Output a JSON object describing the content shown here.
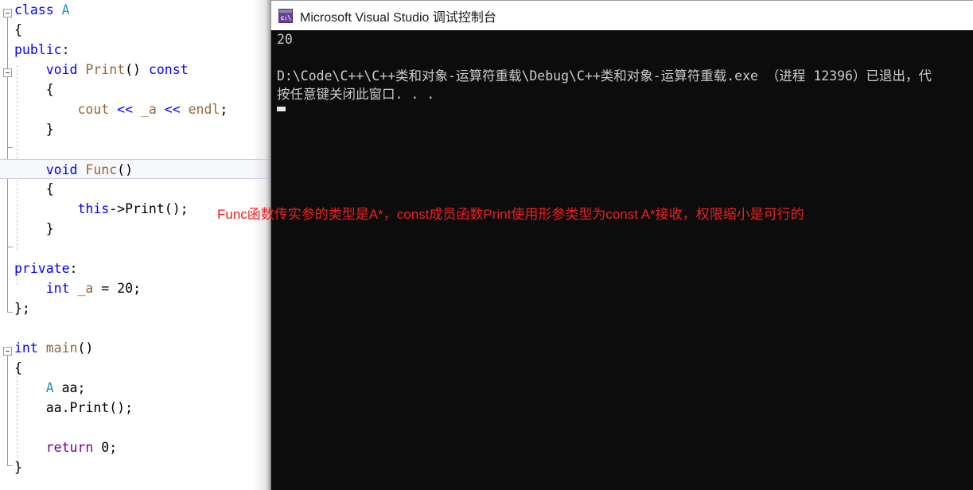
{
  "editor": {
    "name": "visual-studio-code-editor",
    "current_line_index": 8,
    "lines": [
      {
        "indent": 0,
        "tokens": [
          {
            "t": "class ",
            "c": "kw"
          },
          {
            "t": "A",
            "c": "typ"
          }
        ]
      },
      {
        "indent": 0,
        "tokens": [
          {
            "t": "{",
            "c": "pl"
          }
        ]
      },
      {
        "indent": 0,
        "tokens": [
          {
            "t": "public",
            "c": "kw"
          },
          {
            "t": ":",
            "c": "pl"
          }
        ]
      },
      {
        "indent": 1,
        "tokens": [
          {
            "t": "void ",
            "c": "kw"
          },
          {
            "t": "Print",
            "c": "mem"
          },
          {
            "t": "() ",
            "c": "pl"
          },
          {
            "t": "const",
            "c": "kw"
          }
        ]
      },
      {
        "indent": 1,
        "tokens": [
          {
            "t": "{",
            "c": "pl"
          }
        ]
      },
      {
        "indent": 2,
        "tokens": [
          {
            "t": "cout",
            "c": "mem"
          },
          {
            "t": " ",
            "c": "pl"
          },
          {
            "t": "<<",
            "c": "op"
          },
          {
            "t": " ",
            "c": "pl"
          },
          {
            "t": "_a",
            "c": "mem"
          },
          {
            "t": " ",
            "c": "pl"
          },
          {
            "t": "<<",
            "c": "op"
          },
          {
            "t": " ",
            "c": "pl"
          },
          {
            "t": "endl",
            "c": "mem"
          },
          {
            "t": ";",
            "c": "pl"
          }
        ]
      },
      {
        "indent": 1,
        "tokens": [
          {
            "t": "}",
            "c": "pl"
          }
        ]
      },
      {
        "indent": 0,
        "tokens": []
      },
      {
        "indent": 1,
        "tokens": [
          {
            "t": "void ",
            "c": "kw"
          },
          {
            "t": "Func",
            "c": "mem"
          },
          {
            "t": "()",
            "c": "pl"
          }
        ]
      },
      {
        "indent": 1,
        "tokens": [
          {
            "t": "{",
            "c": "pl"
          }
        ]
      },
      {
        "indent": 2,
        "tokens": [
          {
            "t": "this",
            "c": "kw"
          },
          {
            "t": "->",
            "c": "pl"
          },
          {
            "t": "Print",
            "c": "pl"
          },
          {
            "t": "();",
            "c": "pl"
          }
        ]
      },
      {
        "indent": 1,
        "tokens": [
          {
            "t": "}",
            "c": "pl"
          }
        ]
      },
      {
        "indent": 0,
        "tokens": []
      },
      {
        "indent": 0,
        "tokens": [
          {
            "t": "private",
            "c": "kw"
          },
          {
            "t": ":",
            "c": "pl"
          }
        ]
      },
      {
        "indent": 1,
        "tokens": [
          {
            "t": "int",
            "c": "kw"
          },
          {
            "t": " ",
            "c": "pl"
          },
          {
            "t": "_a",
            "c": "mem"
          },
          {
            "t": " = ",
            "c": "pl"
          },
          {
            "t": "20",
            "c": "num"
          },
          {
            "t": ";",
            "c": "pl"
          }
        ]
      },
      {
        "indent": 0,
        "tokens": [
          {
            "t": "};",
            "c": "pl"
          }
        ]
      },
      {
        "indent": 0,
        "tokens": []
      },
      {
        "indent": 0,
        "tokens": [
          {
            "t": "int ",
            "c": "kw"
          },
          {
            "t": "main",
            "c": "mem"
          },
          {
            "t": "()",
            "c": "pl"
          }
        ]
      },
      {
        "indent": 0,
        "tokens": [
          {
            "t": "{",
            "c": "pl"
          }
        ]
      },
      {
        "indent": 1,
        "tokens": [
          {
            "t": "A",
            "c": "typ"
          },
          {
            "t": " aa;",
            "c": "pl"
          }
        ]
      },
      {
        "indent": 1,
        "tokens": [
          {
            "t": "aa.Print();",
            "c": "pl"
          }
        ]
      },
      {
        "indent": 0,
        "tokens": []
      },
      {
        "indent": 1,
        "tokens": [
          {
            "t": "return",
            "c": "usr"
          },
          {
            "t": " ",
            "c": "pl"
          },
          {
            "t": "0",
            "c": "num"
          },
          {
            "t": ";",
            "c": "pl"
          }
        ]
      },
      {
        "indent": 0,
        "tokens": [
          {
            "t": "}",
            "c": "pl"
          }
        ]
      }
    ]
  },
  "annotation": {
    "text": "Func函数传实参的类型是A*，const成员函数Print使用形参类型为const A*接收，权限缩小是可行的",
    "color": "#ef2020"
  },
  "console": {
    "title": "Microsoft Visual Studio 调试控制台",
    "icon": "console-app-icon",
    "icon_glyph": "c:\\",
    "background": "#0c0c0c",
    "text_color": "#cccccc",
    "lines": [
      "20",
      "",
      "D:\\Code\\C++\\C++类和对象-运算符重载\\Debug\\C++类和对象-运算符重载.exe （进程 12396）已退出，代",
      "按任意键关闭此窗口. . ."
    ]
  }
}
